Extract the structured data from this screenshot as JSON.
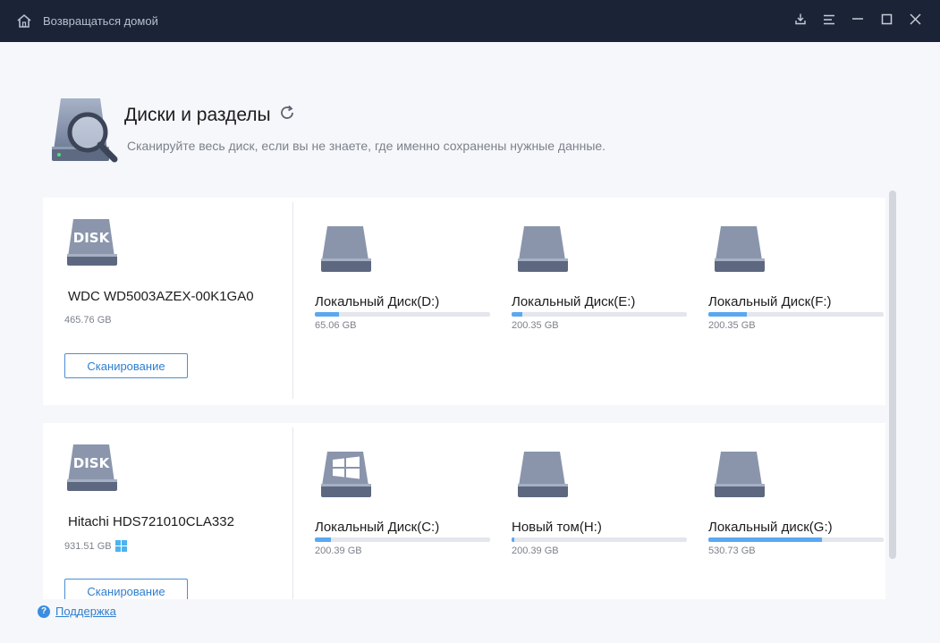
{
  "titlebar": {
    "home_label": "Возвращаться домой",
    "icons": [
      "home-icon",
      "download-icon",
      "menu-icon",
      "minimize-icon",
      "maximize-icon",
      "close-icon"
    ]
  },
  "header": {
    "title": "Диски и разделы",
    "subtitle": "Сканируйте весь диск, если вы не знаете, где именно сохранены нужные данные."
  },
  "disks": [
    {
      "badge": "DISK",
      "name": "WDC WD5003AZEX-00K1GA0",
      "size": "465.76 GB",
      "scan_label": "Сканирование",
      "partitions": [
        {
          "label": "Локальный Диск(D:)",
          "size": "65.06 GB",
          "usage": 0.14,
          "icon": "drive-icon"
        },
        {
          "label": "Локальный Диск(E:)",
          "size": "200.35 GB",
          "usage": 0.06,
          "icon": "drive-icon"
        },
        {
          "label": "Локальный Диск(F:)",
          "size": "200.35 GB",
          "usage": 0.22,
          "icon": "drive-icon"
        }
      ]
    },
    {
      "badge": "DISK",
      "name": "Hitachi HDS721010CLA332",
      "size": "931.51 GB",
      "scan_label": "Сканирование",
      "partitions": [
        {
          "label": "Локальный Диск(C:)",
          "size": "200.39 GB",
          "usage": 0.09,
          "icon": "windows-drive-icon"
        },
        {
          "label": "Новый том(H:)",
          "size": "200.39 GB",
          "usage": 0.015,
          "icon": "drive-icon"
        },
        {
          "label": "Локальный диск(G:)",
          "size": "530.73 GB",
          "usage": 0.65,
          "icon": "drive-icon"
        }
      ]
    }
  ],
  "footer": {
    "support_label": "Поддержка"
  },
  "colors": {
    "titlebar": "#1b2437",
    "accent": "#2f7fcf",
    "bar_fill": "#5ba8f0",
    "bar_track": "#e3e6ec"
  }
}
